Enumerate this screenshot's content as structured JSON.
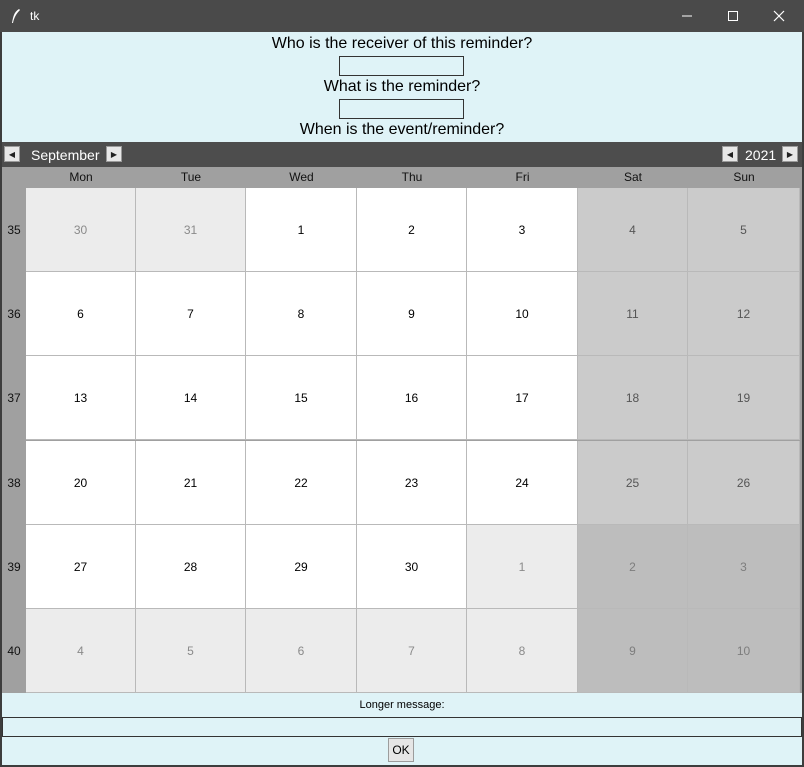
{
  "window": {
    "title": "tk"
  },
  "form": {
    "receiver_label": "Who is the receiver of this reminder?",
    "receiver_value": "",
    "reminder_label": "What is the reminder?",
    "reminder_value": "",
    "when_label": "When is the event/reminder?"
  },
  "calendar": {
    "month": "September",
    "year": "2021",
    "weekdays": [
      "Mon",
      "Tue",
      "Wed",
      "Thu",
      "Fri",
      "Sat",
      "Sun"
    ],
    "weeks": [
      {
        "number": "35",
        "days": [
          {
            "d": "30",
            "t": "other"
          },
          {
            "d": "31",
            "t": "other"
          },
          {
            "d": "1",
            "t": "cur"
          },
          {
            "d": "2",
            "t": "cur"
          },
          {
            "d": "3",
            "t": "cur"
          },
          {
            "d": "4",
            "t": "we"
          },
          {
            "d": "5",
            "t": "we"
          }
        ]
      },
      {
        "number": "36",
        "days": [
          {
            "d": "6",
            "t": "cur"
          },
          {
            "d": "7",
            "t": "cur"
          },
          {
            "d": "8",
            "t": "cur"
          },
          {
            "d": "9",
            "t": "cur"
          },
          {
            "d": "10",
            "t": "cur"
          },
          {
            "d": "11",
            "t": "we"
          },
          {
            "d": "12",
            "t": "we"
          }
        ]
      },
      {
        "number": "37",
        "days": [
          {
            "d": "13",
            "t": "cur"
          },
          {
            "d": "14",
            "t": "cur"
          },
          {
            "d": "15",
            "t": "cur"
          },
          {
            "d": "16",
            "t": "cur"
          },
          {
            "d": "17",
            "t": "cur"
          },
          {
            "d": "18",
            "t": "we"
          },
          {
            "d": "19",
            "t": "we"
          }
        ]
      },
      {
        "number": "38",
        "days": [
          {
            "d": "20",
            "t": "cur"
          },
          {
            "d": "21",
            "t": "cur"
          },
          {
            "d": "22",
            "t": "cur"
          },
          {
            "d": "23",
            "t": "cur"
          },
          {
            "d": "24",
            "t": "cur"
          },
          {
            "d": "25",
            "t": "we"
          },
          {
            "d": "26",
            "t": "we"
          }
        ]
      },
      {
        "number": "39",
        "days": [
          {
            "d": "27",
            "t": "cur"
          },
          {
            "d": "28",
            "t": "cur"
          },
          {
            "d": "29",
            "t": "cur"
          },
          {
            "d": "30",
            "t": "cur"
          },
          {
            "d": "1",
            "t": "other"
          },
          {
            "d": "2",
            "t": "oth-we"
          },
          {
            "d": "3",
            "t": "oth-we"
          }
        ]
      },
      {
        "number": "40",
        "days": [
          {
            "d": "4",
            "t": "other"
          },
          {
            "d": "5",
            "t": "other"
          },
          {
            "d": "6",
            "t": "other"
          },
          {
            "d": "7",
            "t": "other"
          },
          {
            "d": "8",
            "t": "other"
          },
          {
            "d": "9",
            "t": "oth-we"
          },
          {
            "d": "10",
            "t": "oth-we"
          }
        ]
      }
    ]
  },
  "message": {
    "label": "Longer message:",
    "value": ""
  },
  "ok_label": "OK",
  "colors": {
    "background": "#dff3f7",
    "header": "#4d4d4d",
    "titlebar": "#4a4a4a"
  }
}
